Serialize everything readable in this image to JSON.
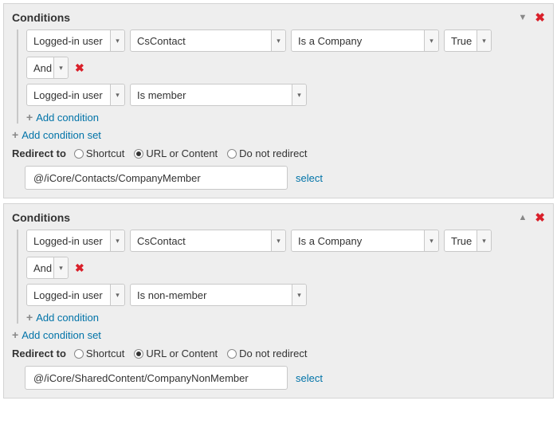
{
  "panels": [
    {
      "title": "Conditions",
      "collapsed": false,
      "collapse_glyph": "▼",
      "conditions": [
        {
          "subject": "Logged-in user",
          "prop": "CsContact",
          "op": "Is a Company",
          "val": "True"
        },
        {
          "join": "And"
        },
        {
          "subject": "Logged-in user",
          "prop": "Is member"
        }
      ],
      "add_condition": "Add condition",
      "add_condition_set": "Add condition set",
      "redirect_label": "Redirect to",
      "radios": {
        "shortcut": "Shortcut",
        "url": "URL or Content",
        "none": "Do not redirect",
        "selected": "url"
      },
      "url_value": "@/iCore/Contacts/CompanyMember",
      "select_label": "select"
    },
    {
      "title": "Conditions",
      "collapsed": true,
      "collapse_glyph": "▲",
      "conditions": [
        {
          "subject": "Logged-in user",
          "prop": "CsContact",
          "op": "Is a Company",
          "val": "True"
        },
        {
          "join": "And"
        },
        {
          "subject": "Logged-in user",
          "prop": "Is non-member"
        }
      ],
      "add_condition": "Add condition",
      "add_condition_set": "Add condition set",
      "redirect_label": "Redirect to",
      "radios": {
        "shortcut": "Shortcut",
        "url": "URL or Content",
        "none": "Do not redirect",
        "selected": "url"
      },
      "url_value": "@/iCore/SharedContent/CompanyNonMember",
      "select_label": "select"
    }
  ]
}
